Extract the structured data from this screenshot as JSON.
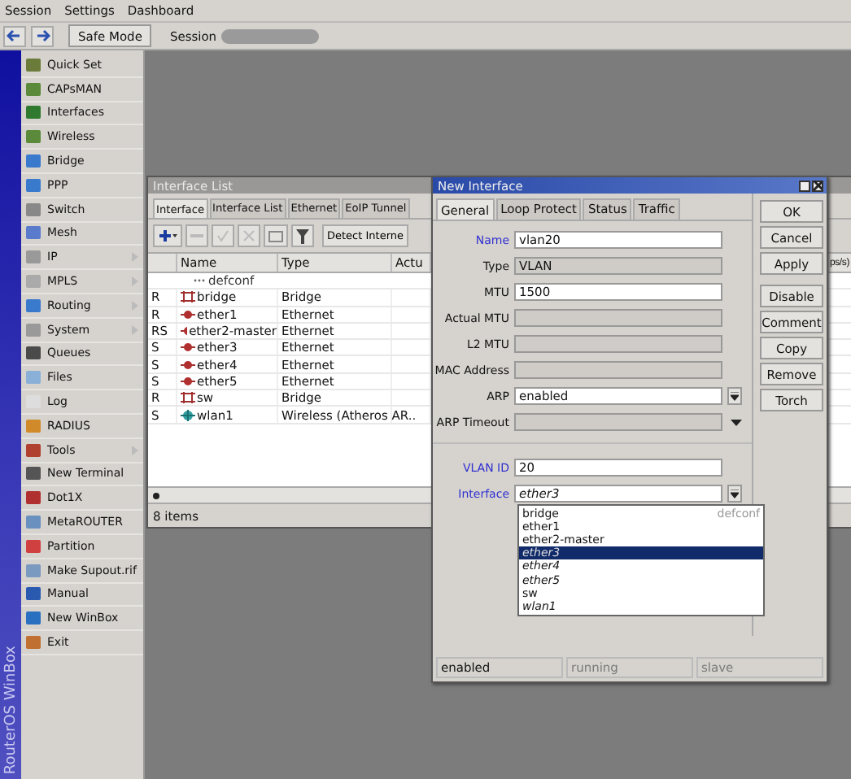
{
  "menu_bar": [
    "Session",
    "Settings",
    "Dashboard"
  ],
  "toolbar": {
    "safe_mode": "Safe Mode",
    "session_label": "Session"
  },
  "sidebar": {
    "brand": "RouterOS WinBox",
    "items": [
      {
        "label": "Quick Set",
        "submenu": false
      },
      {
        "label": "CAPsMAN",
        "submenu": false
      },
      {
        "label": "Interfaces",
        "submenu": false
      },
      {
        "label": "Wireless",
        "submenu": false
      },
      {
        "label": "Bridge",
        "submenu": false
      },
      {
        "label": "PPP",
        "submenu": false
      },
      {
        "label": "Switch",
        "submenu": false
      },
      {
        "label": "Mesh",
        "submenu": false
      },
      {
        "label": "IP",
        "submenu": true
      },
      {
        "label": "MPLS",
        "submenu": true
      },
      {
        "label": "Routing",
        "submenu": true
      },
      {
        "label": "System",
        "submenu": true
      },
      {
        "label": "Queues",
        "submenu": false
      },
      {
        "label": "Files",
        "submenu": false
      },
      {
        "label": "Log",
        "submenu": false
      },
      {
        "label": "RADIUS",
        "submenu": false
      },
      {
        "label": "Tools",
        "submenu": true
      },
      {
        "label": "New Terminal",
        "submenu": false
      },
      {
        "label": "Dot1X",
        "submenu": false
      },
      {
        "label": "MetaROUTER",
        "submenu": false
      },
      {
        "label": "Partition",
        "submenu": false
      },
      {
        "label": "Make Supout.rif",
        "submenu": false
      },
      {
        "label": "Manual",
        "submenu": false
      },
      {
        "label": "New WinBox",
        "submenu": false
      },
      {
        "label": "Exit",
        "submenu": false
      }
    ]
  },
  "interface_list": {
    "title": "Interface List",
    "tabs": [
      {
        "label": "Interface",
        "selected": true
      },
      {
        "label": "Interface List",
        "selected": false
      },
      {
        "label": "Ethernet",
        "selected": false
      },
      {
        "label": "EoIP Tunnel",
        "selected": false
      }
    ],
    "detect_button": "Detect Interne",
    "columns": [
      "Name",
      "Type",
      "Actu",
      "ps/s)"
    ],
    "comment": "defconf",
    "rows": [
      {
        "flags": "R",
        "name": "bridge",
        "type": "Bridge",
        "kind": "bridge"
      },
      {
        "flags": "R",
        "name": "ether1",
        "type": "Ethernet",
        "kind": "ethernet"
      },
      {
        "flags": "RS",
        "name": "ether2-master",
        "type": "Ethernet",
        "kind": "ethernet"
      },
      {
        "flags": "S",
        "name": "ether3",
        "type": "Ethernet",
        "kind": "ethernet"
      },
      {
        "flags": "S",
        "name": "ether4",
        "type": "Ethernet",
        "kind": "ethernet"
      },
      {
        "flags": "S",
        "name": "ether5",
        "type": "Ethernet",
        "kind": "ethernet"
      },
      {
        "flags": "R",
        "name": "sw",
        "type": "Bridge",
        "kind": "bridge"
      },
      {
        "flags": "S",
        "name": "wlan1",
        "type": "Wireless (Atheros AR..",
        "kind": "wireless"
      }
    ],
    "footer": "8 items"
  },
  "new_interface": {
    "title": "New Interface",
    "tabs": [
      {
        "label": "General",
        "selected": true
      },
      {
        "label": "Loop Protect",
        "selected": false
      },
      {
        "label": "Status",
        "selected": false
      },
      {
        "label": "Traffic",
        "selected": false
      }
    ],
    "fields": [
      {
        "label": "Name",
        "value": "vlan20",
        "kind": "text",
        "disabled": false,
        "highlight": true
      },
      {
        "label": "Type",
        "value": "VLAN",
        "kind": "text",
        "disabled": true,
        "highlight": false
      },
      {
        "label": "MTU",
        "value": "1500",
        "kind": "text",
        "disabled": false,
        "highlight": false
      },
      {
        "label": "Actual MTU",
        "kind": "text",
        "disabled": true,
        "highlight": false
      },
      {
        "label": "L2 MTU",
        "kind": "text",
        "disabled": true,
        "highlight": false
      },
      {
        "label": "MAC Address",
        "kind": "text",
        "disabled": true,
        "highlight": false
      },
      {
        "label": "ARP",
        "value": "enabled",
        "kind": "select",
        "disabled": false,
        "highlight": false
      },
      {
        "label": "ARP Timeout",
        "kind": "optional",
        "disabled": true,
        "highlight": false
      },
      {
        "label": "VLAN ID",
        "value": "20",
        "kind": "text",
        "disabled": false,
        "highlight": true,
        "separator": true
      },
      {
        "label": "Interface",
        "value": "ether3",
        "kind": "select",
        "disabled": false,
        "highlight": true,
        "italic": true
      }
    ],
    "dropdown": [
      {
        "label": "bridge",
        "comment": "defconf",
        "italic": false,
        "selected": false
      },
      {
        "label": "ether1",
        "italic": false,
        "selected": false
      },
      {
        "label": "ether2-master",
        "italic": false,
        "selected": false
      },
      {
        "label": "ether3",
        "italic": true,
        "selected": true
      },
      {
        "label": "ether4",
        "italic": true,
        "selected": false
      },
      {
        "label": "ether5",
        "italic": true,
        "selected": false
      },
      {
        "label": "sw",
        "italic": false,
        "selected": false
      },
      {
        "label": "wlan1",
        "italic": true,
        "selected": false
      }
    ],
    "buttons": [
      "OK",
      "Cancel",
      "Apply",
      "Disable",
      "Comment",
      "Copy",
      "Remove",
      "Torch"
    ],
    "status": [
      {
        "label": "enabled",
        "active": true
      },
      {
        "label": "running",
        "active": false
      },
      {
        "label": "slave",
        "active": false
      }
    ]
  }
}
